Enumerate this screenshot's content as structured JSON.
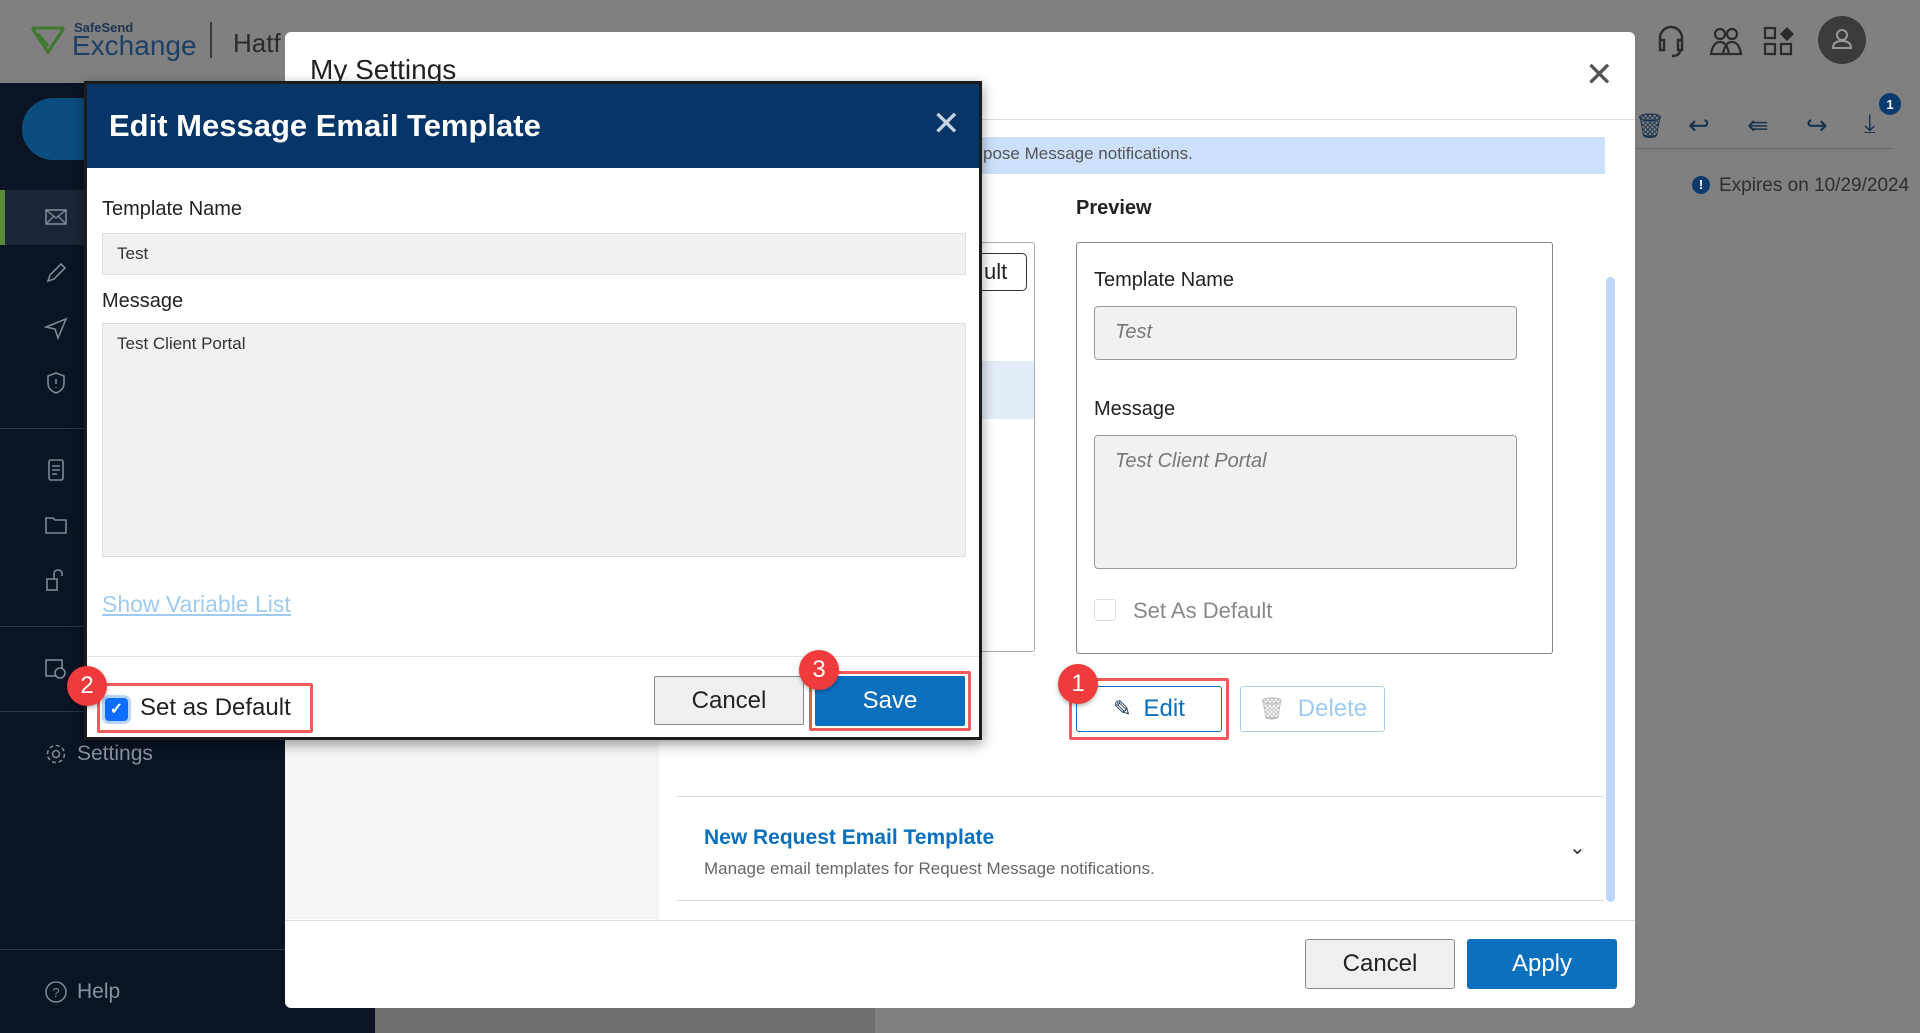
{
  "header": {
    "logo_top": "SafeSend",
    "logo_bottom": "Exchange",
    "company": "Hatf",
    "expires": "Expires on 10/29/2024",
    "download_badge": "1"
  },
  "sidebar": {
    "settings": "Settings",
    "help": "Help"
  },
  "settings_modal": {
    "title": "My Settings",
    "banner": "pose Message notifications.",
    "list_button": "ult",
    "preview": {
      "heading": "Preview",
      "name_label": "Template Name",
      "name_value": "Test",
      "message_label": "Message",
      "message_value": "Test Client Portal",
      "default_label": "Set As Default",
      "default_checked": false
    },
    "edit": "Edit",
    "delete": "Delete",
    "section": {
      "title": "New Request Email Template",
      "desc": "Manage email templates for Request Message notifications."
    },
    "cancel": "Cancel",
    "apply": "Apply"
  },
  "edit_dialog": {
    "title": "Edit Message Email Template",
    "name_label": "Template Name",
    "name_value": "Test",
    "message_label": "Message",
    "message_value": "Test Client Portal",
    "variables_link": "Show Variable List",
    "default_label": "Set as Default",
    "default_checked": true,
    "cancel": "Cancel",
    "save": "Save"
  },
  "steps": [
    "1",
    "2",
    "3"
  ],
  "colors": {
    "primary": "#0a6fbd",
    "dialog_header": "#063567",
    "highlight": "#f05a5a",
    "badge": "#ef3b3b"
  }
}
